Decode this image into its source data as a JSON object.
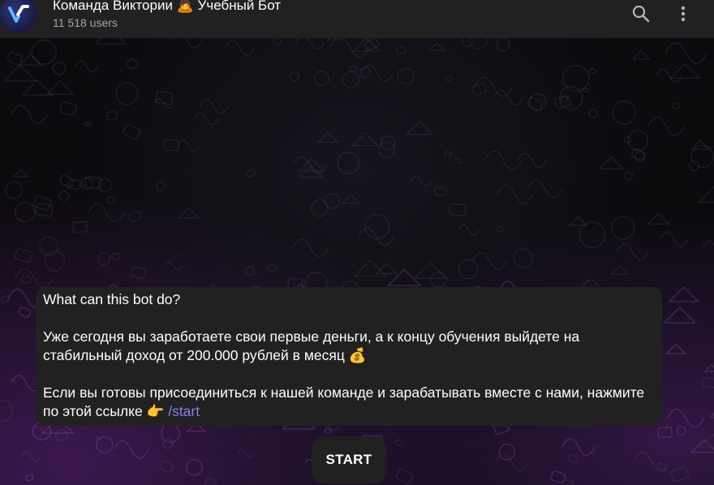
{
  "header": {
    "title": "Команда Виктории 🙇 Учебный Бот",
    "members": "11 518 users",
    "avatar_letter": "V",
    "icons": {
      "search": "search-icon",
      "more": "more-vertical-icon"
    }
  },
  "message": {
    "heading": "What can this bot do?",
    "para1": "Уже сегодня вы заработаете свои первые деньги, а к концу обучения выйдете на стабильный доход от 200.000 рублей в месяц 💰",
    "para2_text": "Если вы готовы присоединиться к нашей команде и зарабатывать вместе с нами, нажмите по этой ссылке 👉 ",
    "para2_link": "/start"
  },
  "start_button": {
    "label": "START"
  },
  "colors": {
    "header_bg": "#212121",
    "bubble_bg": "#212121",
    "link": "#8f7cf0",
    "background_tint": "#7a2aa0"
  }
}
